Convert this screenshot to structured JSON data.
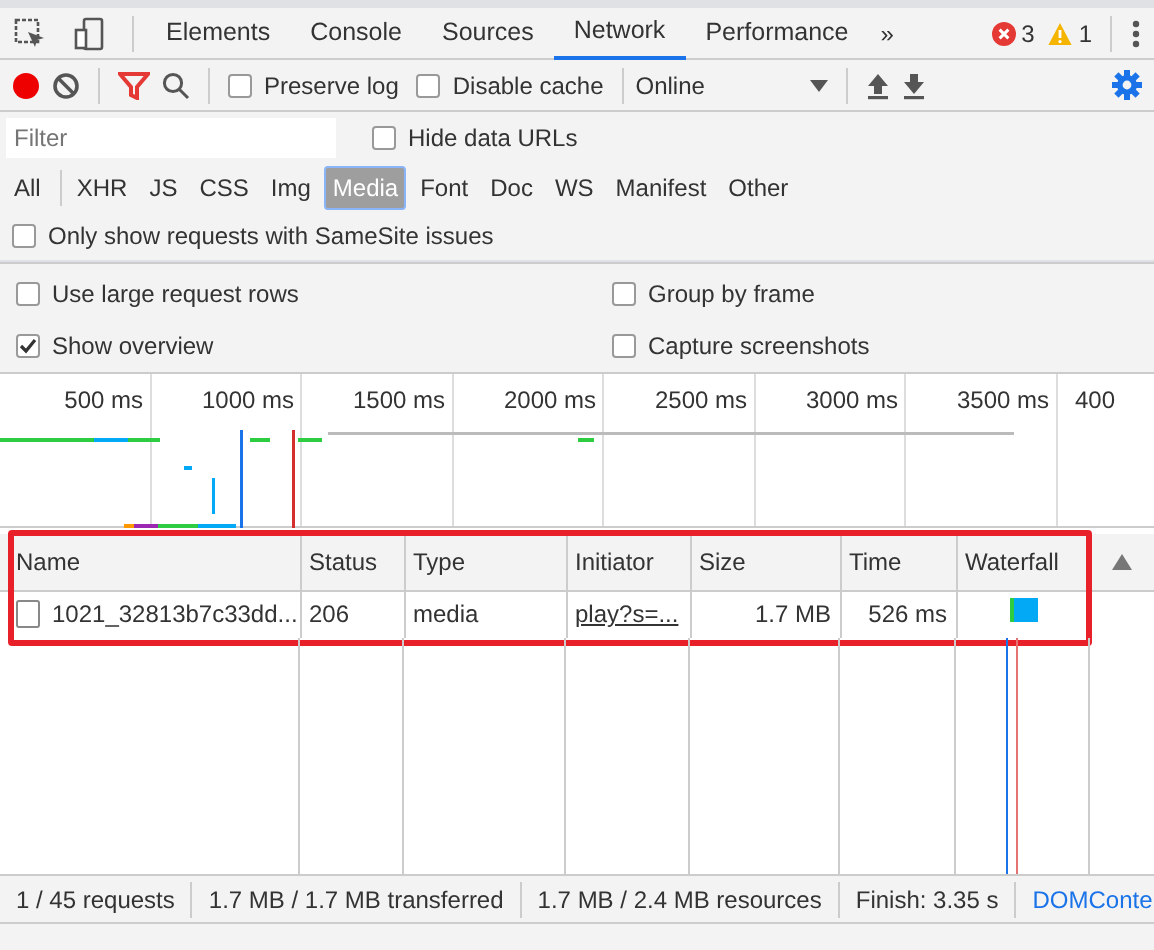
{
  "tabs": [
    {
      "label": "Elements",
      "selected": false
    },
    {
      "label": "Console",
      "selected": false
    },
    {
      "label": "Sources",
      "selected": false
    },
    {
      "label": "Network",
      "selected": true
    },
    {
      "label": "Performance",
      "selected": false
    }
  ],
  "more_tabs": "»",
  "errors": "3",
  "warnings": "1",
  "toolbar": {
    "recording": true,
    "checkboxes": [
      {
        "label": "Preserve log",
        "checked": false
      },
      {
        "label": "Disable cache",
        "checked": false
      }
    ],
    "throttling": "Online"
  },
  "filter": {
    "placeholder": "Filter",
    "hide_data_urls": {
      "label": "Hide data URLs",
      "checked": false
    }
  },
  "type_filters": [
    {
      "label": "All",
      "selected": false
    },
    {
      "label": "XHR",
      "selected": false
    },
    {
      "label": "JS",
      "selected": false
    },
    {
      "label": "CSS",
      "selected": false
    },
    {
      "label": "Img",
      "selected": false
    },
    {
      "label": "Media",
      "selected": true
    },
    {
      "label": "Font",
      "selected": false
    },
    {
      "label": "Doc",
      "selected": false
    },
    {
      "label": "WS",
      "selected": false
    },
    {
      "label": "Manifest",
      "selected": false
    },
    {
      "label": "Other",
      "selected": false
    }
  ],
  "samesite": {
    "label": "Only show requests with SameSite issues",
    "checked": false
  },
  "settings": [
    {
      "label": "Use large request rows",
      "checked": false
    },
    {
      "label": "Group by frame",
      "checked": false
    },
    {
      "label": "Show overview",
      "checked": true
    },
    {
      "label": "Capture screenshots",
      "checked": false
    }
  ],
  "overview": {
    "ticks": [
      "500 ms",
      "1000 ms",
      "1500 ms",
      "2000 ms",
      "2500 ms",
      "3000 ms",
      "3500 ms",
      "400"
    ]
  },
  "table": {
    "highlighted": true,
    "columns": [
      "Name",
      "Status",
      "Type",
      "Initiator",
      "Size",
      "Time",
      "Waterfall"
    ],
    "rows": [
      {
        "name": "1021_32813b7c33dd...",
        "status": "206",
        "type": "media",
        "initiator": "play?s=...",
        "size": "1.7 MB",
        "time": "526 ms"
      }
    ]
  },
  "status_bar": [
    {
      "text": "1 / 45 requests",
      "kind": "plain"
    },
    {
      "text": "1.7 MB / 1.7 MB transferred",
      "kind": "plain"
    },
    {
      "text": "1.7 MB / 2.4 MB resources",
      "kind": "plain"
    },
    {
      "text": "Finish: 3.35 s",
      "kind": "plain"
    },
    {
      "text": "DOMConte",
      "kind": "link"
    }
  ]
}
